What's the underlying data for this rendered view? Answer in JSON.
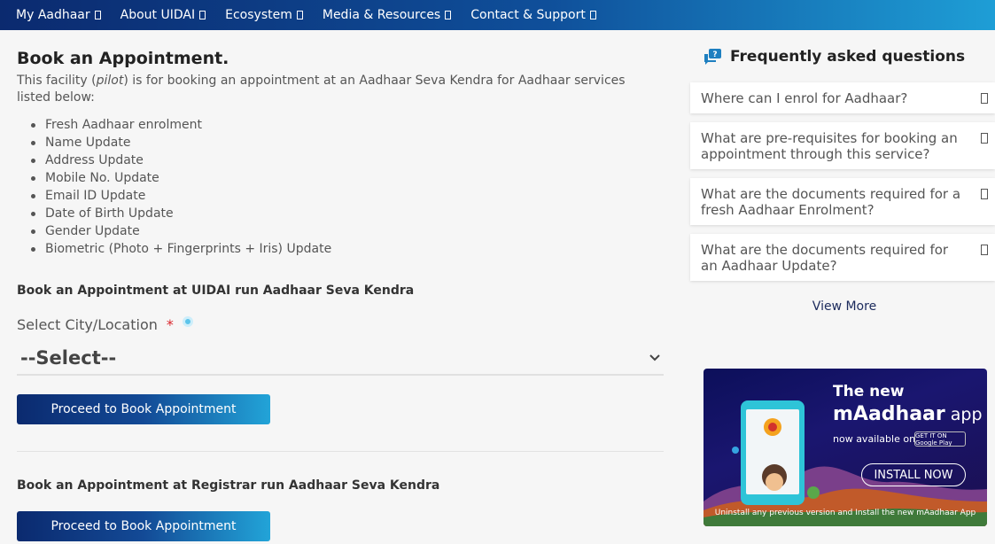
{
  "nav": {
    "items": [
      {
        "label": "My Aadhaar"
      },
      {
        "label": "About UIDAI"
      },
      {
        "label": "Ecosystem"
      },
      {
        "label": "Media & Resources"
      },
      {
        "label": "Contact & Support"
      }
    ]
  },
  "main": {
    "title": "Book an Appointment.",
    "intro_before": "This facility (",
    "intro_italic": "pilot",
    "intro_after": ") is for booking an appointment at an Aadhaar Seva Kendra for Aadhaar services listed below:",
    "services": [
      "Fresh Aadhaar enrolment",
      "Name Update",
      "Address Update",
      "Mobile No. Update",
      "Email ID Update",
      "Date of Birth Update",
      "Gender Update",
      "Biometric (Photo + Fingerprints + Iris) Update"
    ],
    "section_uidai": "Book an Appointment at UIDAI run Aadhaar Seva Kendra",
    "city_label": "Select City/Location",
    "required_mark": "*",
    "select_value": "--Select--",
    "proceed_label": "Proceed to Book Appointment",
    "section_registrar": "Book an Appointment at Registrar run Aadhaar Seva Kendra",
    "proceed_label_2": "Proceed to Book Appointment"
  },
  "faq": {
    "title": "Frequently asked questions",
    "items": [
      "Where can I enrol for Aadhaar?",
      "What are pre-requisites for booking an appointment through this service?",
      "What are the documents required for a fresh Aadhaar Enrolment?",
      "What are the documents required for an Aadhaar Update?"
    ],
    "view_more": "View More"
  },
  "banner": {
    "line1": "The new",
    "app_bold": "mAadhaar",
    "app_rest": " app",
    "available": "now available on",
    "store": "GET IT ON Google Play",
    "install": "INSTALL NOW",
    "note": "Uninstall any previous version and Install the new mAadhaar App"
  },
  "colors": {
    "nav_start": "#0b2a6f",
    "nav_end": "#1e9ed6",
    "required": "#d9262c",
    "info": "#5cc4ea"
  }
}
